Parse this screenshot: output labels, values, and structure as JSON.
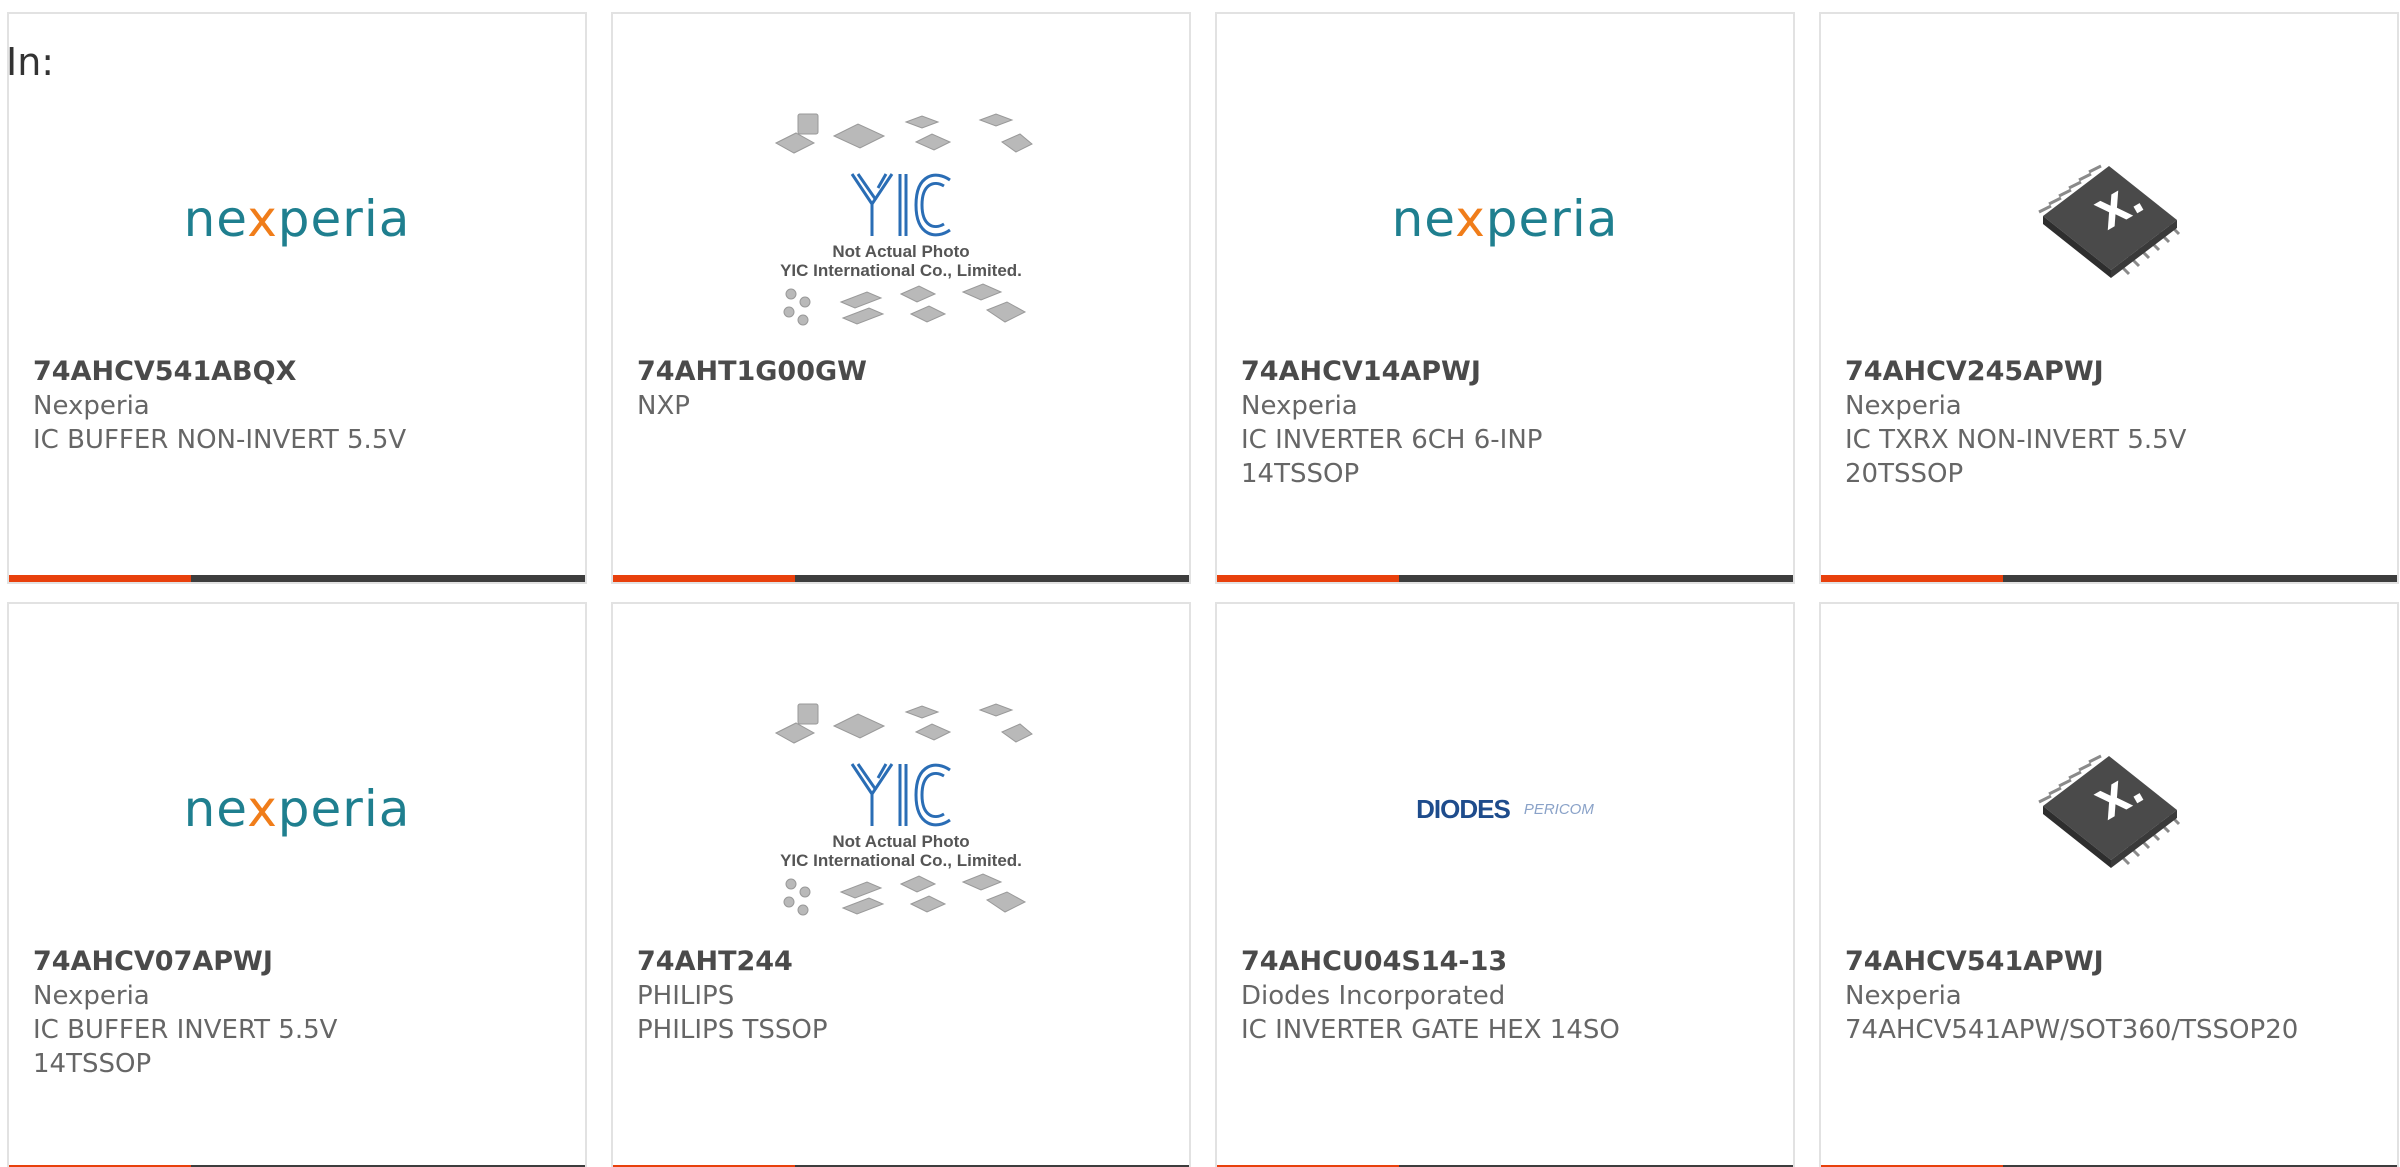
{
  "header": {
    "label": "In:"
  },
  "products": [
    {
      "part_number": "74AHCV541ABQX",
      "manufacturer": "Nexperia",
      "description_lines": [
        "IC BUFFER NON-INVERT 5.5V",
        ""
      ],
      "image": "nexperia-logo",
      "logo_text": {
        "pre": "ne",
        "x": "x",
        "post": "peria"
      }
    },
    {
      "part_number": "74AHT1G00GW",
      "manufacturer": "NXP",
      "description_lines": [
        "",
        ""
      ],
      "image": "yic-not-actual-photo",
      "yic_lines": [
        "Not Actual Photo",
        "YIC International Co., Limited."
      ]
    },
    {
      "part_number": "74AHCV14APWJ",
      "manufacturer": "Nexperia",
      "description_lines": [
        "IC INVERTER 6CH 6-INP",
        "14TSSOP"
      ],
      "image": "nexperia-logo",
      "logo_text": {
        "pre": "ne",
        "x": "x",
        "post": "peria"
      }
    },
    {
      "part_number": "74AHCV245APWJ",
      "manufacturer": "Nexperia",
      "description_lines": [
        "IC TXRX NON-INVERT 5.5V",
        "20TSSOP"
      ],
      "image": "nexperia-chip-photo"
    },
    {
      "part_number": "74AHCV07APWJ",
      "manufacturer": "Nexperia",
      "description_lines": [
        "IC BUFFER INVERT 5.5V",
        "14TSSOP"
      ],
      "image": "nexperia-logo",
      "logo_text": {
        "pre": "ne",
        "x": "x",
        "post": "peria"
      }
    },
    {
      "part_number": "74AHT244",
      "manufacturer": "PHILIPS",
      "description_lines": [
        "PHILIPS TSSOP",
        ""
      ],
      "image": "yic-not-actual-photo",
      "yic_lines": [
        "Not Actual Photo",
        "YIC International Co., Limited."
      ]
    },
    {
      "part_number": "74AHCU04S14-13",
      "manufacturer": "Diodes Incorporated",
      "description_lines": [
        "IC INVERTER GATE HEX 14SO",
        ""
      ],
      "image": "diodes-pericom-logo",
      "logo_text": {
        "main": "DIODES",
        "sub": "PERICOM"
      }
    },
    {
      "part_number": "74AHCV541APWJ",
      "manufacturer": "Nexperia",
      "description_lines": [
        "74AHCV541APW/SOT360/TSSOP20",
        ""
      ],
      "image": "nexperia-chip-photo"
    }
  ],
  "colors": {
    "accent": "#e8400c",
    "bar": "#3d3d3d",
    "border": "#e2e2e2",
    "nexperia_teal": "#1f7f8f",
    "nexperia_orange": "#f07d1a",
    "yic_blue": "#2a6db5"
  }
}
